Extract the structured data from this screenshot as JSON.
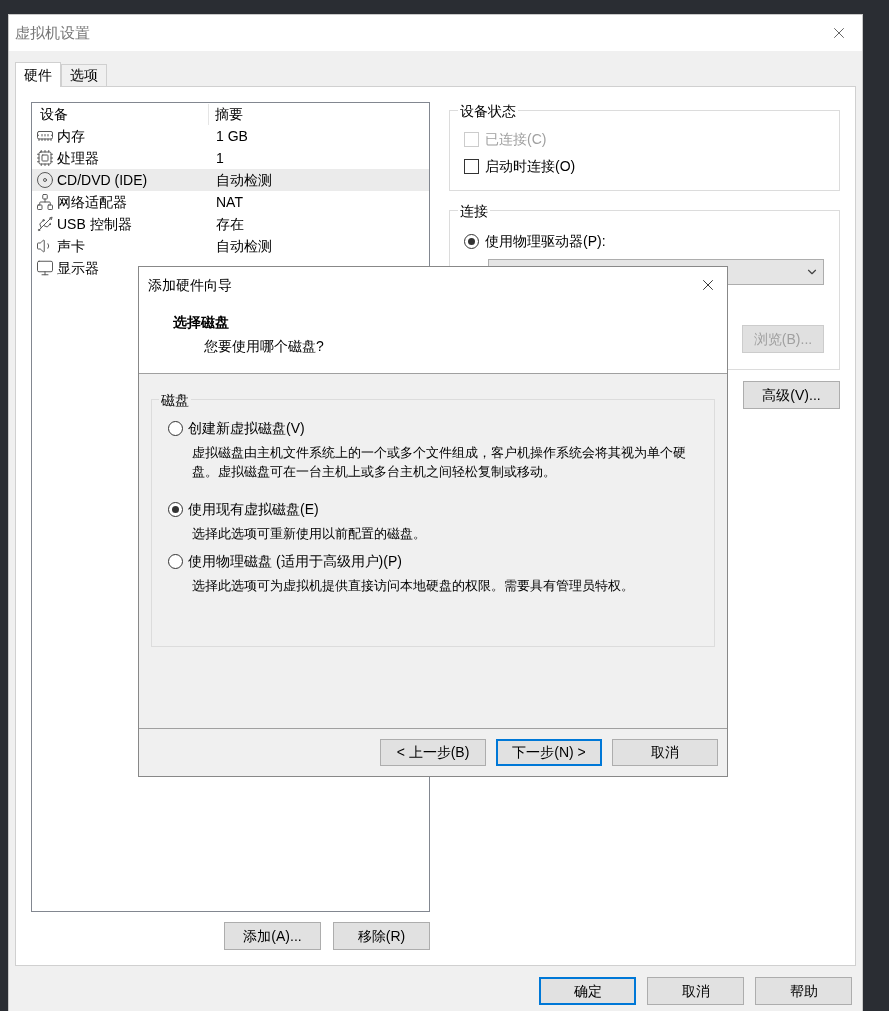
{
  "window": {
    "title": "虚拟机设置"
  },
  "tabs": [
    {
      "label": "硬件",
      "selected": true
    },
    {
      "label": "选项",
      "selected": false
    }
  ],
  "device_table": {
    "columns": [
      "设备",
      "摘要"
    ],
    "rows": [
      {
        "kind": "memory",
        "device": "内存",
        "summary": "1 GB",
        "selected": false
      },
      {
        "kind": "cpu",
        "device": "处理器",
        "summary": "1",
        "selected": false
      },
      {
        "kind": "disc",
        "device": "CD/DVD (IDE)",
        "summary": "自动检测",
        "selected": true
      },
      {
        "kind": "network",
        "device": "网络适配器",
        "summary": "NAT",
        "selected": false
      },
      {
        "kind": "usb",
        "device": "USB 控制器",
        "summary": "存在",
        "selected": false
      },
      {
        "kind": "sound",
        "device": "声卡",
        "summary": "自动检测",
        "selected": false
      },
      {
        "kind": "display",
        "device": "显示器",
        "selected": false
      }
    ]
  },
  "device_buttons": [
    "添加(A)...",
    "移除(R)"
  ],
  "device_status": {
    "title": "设备状态",
    "options": [
      {
        "label": "已连接(C)",
        "checked": false,
        "disabled": true
      },
      {
        "label": "启动时连接(O)",
        "checked": false,
        "disabled": false
      }
    ]
  },
  "connection": {
    "title": "连接",
    "options": [
      {
        "label": "使用物理驱动器(P):",
        "selected": true
      }
    ],
    "browse_button": {
      "label": "浏览(B)...",
      "disabled": true
    }
  },
  "advanced_button": "高级(V)...",
  "footer_buttons": [
    {
      "label": "确定",
      "default": true
    },
    {
      "label": "取消",
      "default": false
    },
    {
      "label": "帮助",
      "default": false
    }
  ],
  "wizard": {
    "title": "添加硬件向导",
    "heading": "选择磁盘",
    "subheading": "您要使用哪个磁盘?",
    "group_title": "磁盘",
    "options": [
      {
        "label": "创建新虚拟磁盘(V)",
        "description": "虚拟磁盘由主机文件系统上的一个或多个文件组成，客户机操作系统会将其视为单个硬盘。虚拟磁盘可在一台主机上或多台主机之间轻松复制或移动。",
        "selected": false
      },
      {
        "label": "使用现有虚拟磁盘(E)",
        "description": "选择此选项可重新使用以前配置的磁盘。",
        "selected": true
      },
      {
        "label": "使用物理磁盘 (适用于高级用户)(P)",
        "description": "选择此选项可为虚拟机提供直接访问本地硬盘的权限。需要具有管理员特权。",
        "selected": false
      }
    ],
    "buttons": [
      {
        "label": "< 上一步(B)",
        "default": false
      },
      {
        "label": "下一步(N) >",
        "default": true
      },
      {
        "label": "取消",
        "default": false
      }
    ]
  }
}
